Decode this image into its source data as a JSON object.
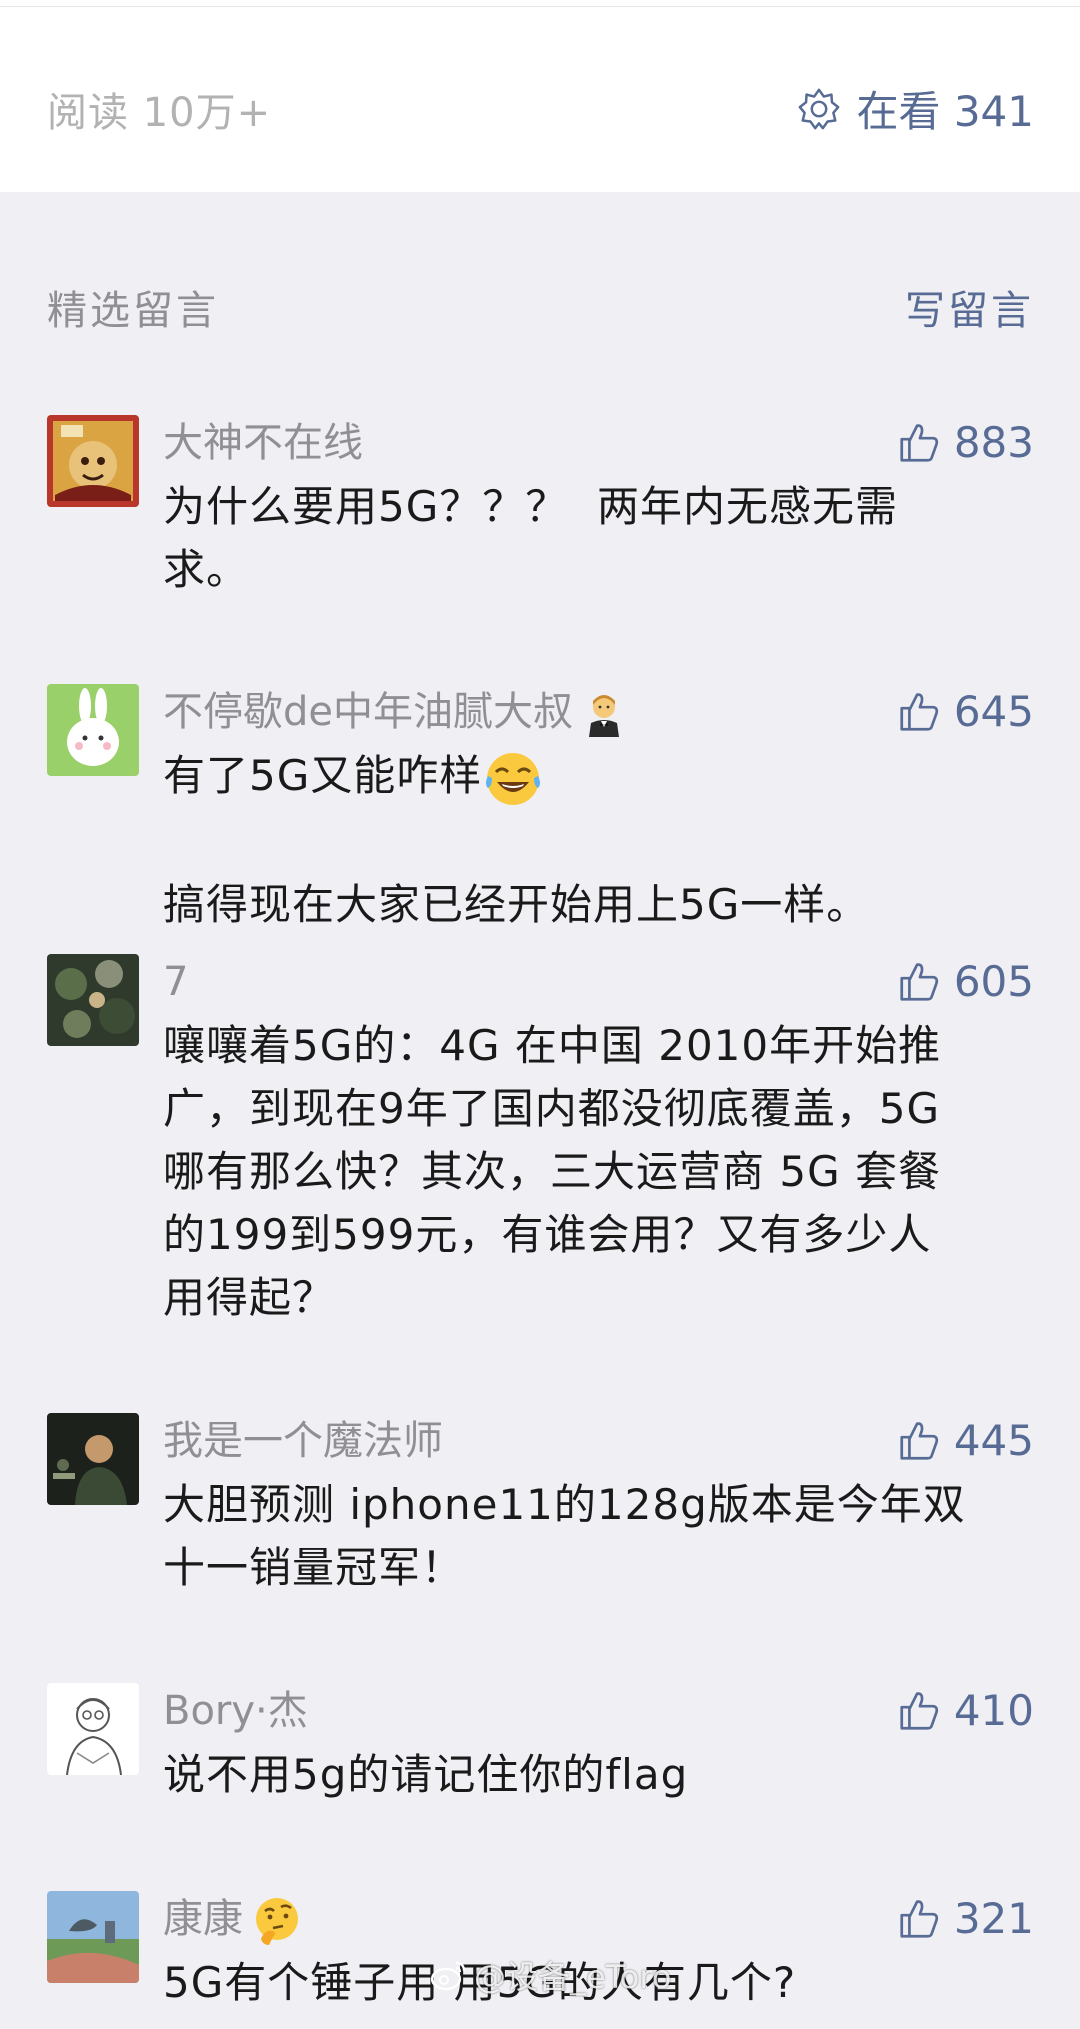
{
  "stats": {
    "read_label": "阅读 10万+",
    "looking_label": "在看 341"
  },
  "section": {
    "title": "精选留言",
    "write_label": "写留言"
  },
  "comments": [
    {
      "nickname": "大神不在线",
      "likes": "883",
      "text": "为什么要用5G？？？  两年内无感无需\n求。",
      "avatar": "red-illustration-avatar"
    },
    {
      "nickname": "不停歇de中年油腻大叔",
      "nickname_emoji": "man-in-tuxedo-emoji",
      "likes": "645",
      "text": "有了5G又能咋样",
      "text_emoji": "tears-of-joy-emoji",
      "text_line2": "搞得现在大家已经开始用上5G一样。",
      "avatar": "green-bunny-avatar"
    },
    {
      "nickname": "7",
      "likes": "605",
      "text": "嚷嚷着5G的：4G 在中国 2010年开始推\n广，到现在9年了国内都没彻底覆盖，5G\n哪有那么快？其次，三大运营商 5G 套餐\n的199到599元，有谁会用？又有多少人\n用得起？",
      "avatar": "dark-photo-avatar"
    },
    {
      "nickname": "我是一个魔法师",
      "likes": "445",
      "text": "大胆预测 iphone11的128g版本是今年双\n十一销量冠军！",
      "avatar": "night-photo-avatar"
    },
    {
      "nickname": "Bory·杰",
      "likes": "410",
      "text": "说不用5g的请记住你的flag",
      "avatar": "sketch-avatar"
    },
    {
      "nickname": "康康",
      "nickname_emoji": "thinking-face-emoji",
      "likes": "321",
      "text": "5G有个锤子用 用5G的人有几个?",
      "avatar": "landscape-avatar"
    }
  ],
  "watermark": {
    "text": "@设备_eToro",
    "icon": "weibo-icon"
  },
  "colors": {
    "link_blue": "#576b95",
    "gray_text": "#8f8f94",
    "body_text": "#1a1a1a",
    "background": "#efeff4"
  }
}
